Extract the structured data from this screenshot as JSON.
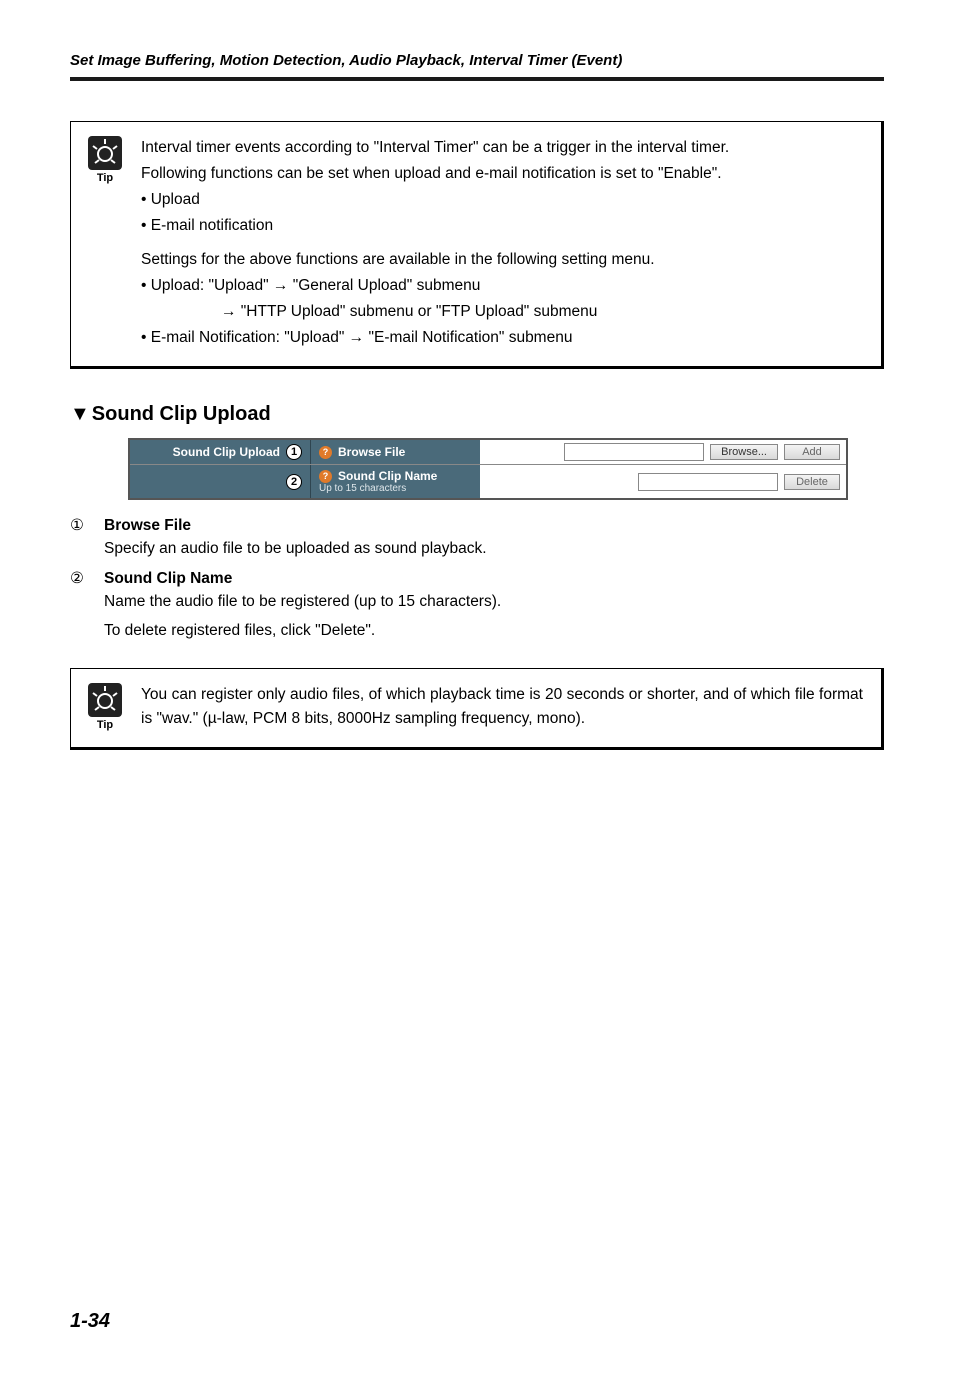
{
  "header": {
    "running": "Set Image Buffering, Motion Detection, Audio Playback, Interval Timer (Event)"
  },
  "tip1": {
    "icon_label": "Tip",
    "p1": "Interval timer events according to \"Interval Timer\" can be a trigger in the interval timer.",
    "p2": "Following functions can be set when upload and e-mail notification is set to \"Enable\".",
    "b1": "• Upload",
    "b2": "• E-mail notification",
    "p3": "Settings for the above functions are available in the following setting menu.",
    "u1": "• Upload: \"Upload\" → \"General Upload\" submenu",
    "u2": "→ \"HTTP Upload\" submenu or \"FTP Upload\" submenu",
    "e1": "• E-mail Notification: \"Upload\" → \"E-mail Notification\" submenu"
  },
  "section": {
    "heading": "Sound Clip Upload"
  },
  "shot": {
    "row1_label": "Sound Clip Upload",
    "row1_field": "Browse File",
    "row1_browse": "Browse...",
    "row1_add": "Add",
    "row2_field": "Sound Clip Name",
    "row2_sub": "Up to 15 characters",
    "row2_delete": "Delete"
  },
  "defs": {
    "n1": "①",
    "t1": "Browse File",
    "d1": "Specify an audio file to be uploaded as sound playback.",
    "n2": "②",
    "t2": "Sound Clip Name",
    "d2a": "Name the audio file to be registered (up to 15 characters).",
    "d2b": "To delete registered files, click \"Delete\"."
  },
  "tip2": {
    "icon_label": "Tip",
    "p1": "You can register only audio files, of which playback time is 20 seconds or shorter, and of which file format is \"wav.\" (µ-law, PCM 8 bits, 8000Hz sampling frequency, mono)."
  },
  "footer": {
    "page": "1-34"
  }
}
